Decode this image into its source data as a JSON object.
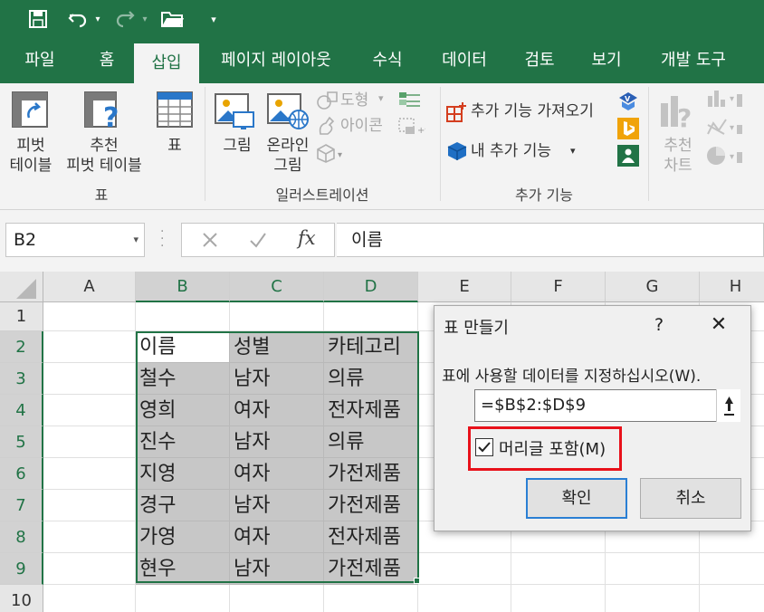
{
  "ribbon": {
    "tabs": [
      "파일",
      "홈",
      "삽입",
      "페이지 레이아웃",
      "수식",
      "데이터",
      "검토",
      "보기",
      "개발 도구"
    ],
    "active_tab": "삽입",
    "buttons": {
      "pivot_l1": "피벗",
      "pivot_l2": "테이블",
      "rec_pivot_l1": "추천",
      "rec_pivot_l2": "피벗 테이블",
      "table": "표",
      "picture": "그림",
      "online_l1": "온라인",
      "online_l2": "그림",
      "shapes": "도형",
      "icons": "아이콘",
      "get_addins": "추가 기능 가져오기",
      "my_addins": "내 추가 기능",
      "rec_chart_l1": "추천",
      "rec_chart_l2": "차트"
    },
    "groups": {
      "tables": "표",
      "illustrations": "일러스트레이션",
      "addins": "추가 기능"
    }
  },
  "formula_bar": {
    "name_box": "B2",
    "formula": "이름"
  },
  "sheet": {
    "columns": [
      "A",
      "B",
      "C",
      "D",
      "E",
      "F",
      "G",
      "H"
    ],
    "rows": [
      "1",
      "2",
      "3",
      "4",
      "5",
      "6",
      "7",
      "8",
      "9",
      "10"
    ],
    "data": [
      [
        "이름",
        "성별",
        "카테고리"
      ],
      [
        "철수",
        "남자",
        "의류"
      ],
      [
        "영희",
        "여자",
        "전자제품"
      ],
      [
        "진수",
        "남자",
        "의류"
      ],
      [
        "지영",
        "여자",
        "가전제품"
      ],
      [
        "경구",
        "남자",
        "가전제품"
      ],
      [
        "가영",
        "여자",
        "전자제품"
      ],
      [
        "현우",
        "남자",
        "가전제품"
      ]
    ]
  },
  "dialog": {
    "title": "표 만들기",
    "help": "?",
    "prompt": "표에 사용할 데이터를 지정하십시오(W).",
    "range": "=$B$2:$D$9",
    "checkbox_label": "머리글 포함(M)",
    "checkbox_checked": true,
    "ok": "확인",
    "cancel": "취소"
  },
  "colors": {
    "excel_green": "#217346",
    "highlight_red": "#e8111a",
    "selection_fill": "#c7c7c7"
  }
}
